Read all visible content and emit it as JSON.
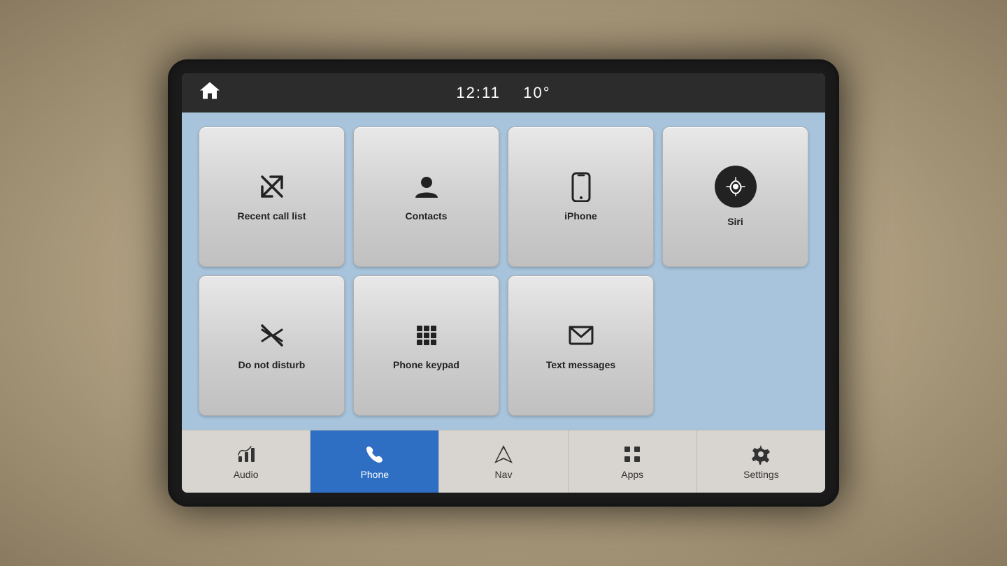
{
  "topbar": {
    "time": "12:11",
    "temperature": "10°",
    "home_label": "home"
  },
  "grid_buttons": [
    {
      "id": "recent-call-list",
      "label": "Recent call list",
      "icon_type": "recent-calls"
    },
    {
      "id": "contacts",
      "label": "Contacts",
      "icon_type": "contacts"
    },
    {
      "id": "iphone",
      "label": "iPhone",
      "icon_type": "phone"
    },
    {
      "id": "siri",
      "label": "Siri",
      "icon_type": "siri"
    },
    {
      "id": "do-not-disturb",
      "label": "Do not disturb",
      "icon_type": "do-not-disturb"
    },
    {
      "id": "phone-keypad",
      "label": "Phone keypad",
      "icon_type": "keypad"
    },
    {
      "id": "text-messages",
      "label": "Text messages",
      "icon_type": "messages"
    }
  ],
  "nav_items": [
    {
      "id": "audio",
      "label": "Audio",
      "active": false,
      "icon_type": "music"
    },
    {
      "id": "phone",
      "label": "Phone",
      "active": true,
      "icon_type": "phone"
    },
    {
      "id": "nav",
      "label": "Nav",
      "active": false,
      "icon_type": "nav"
    },
    {
      "id": "apps",
      "label": "Apps",
      "active": false,
      "icon_type": "apps"
    },
    {
      "id": "settings",
      "label": "Settings",
      "active": false,
      "icon_type": "settings"
    }
  ]
}
